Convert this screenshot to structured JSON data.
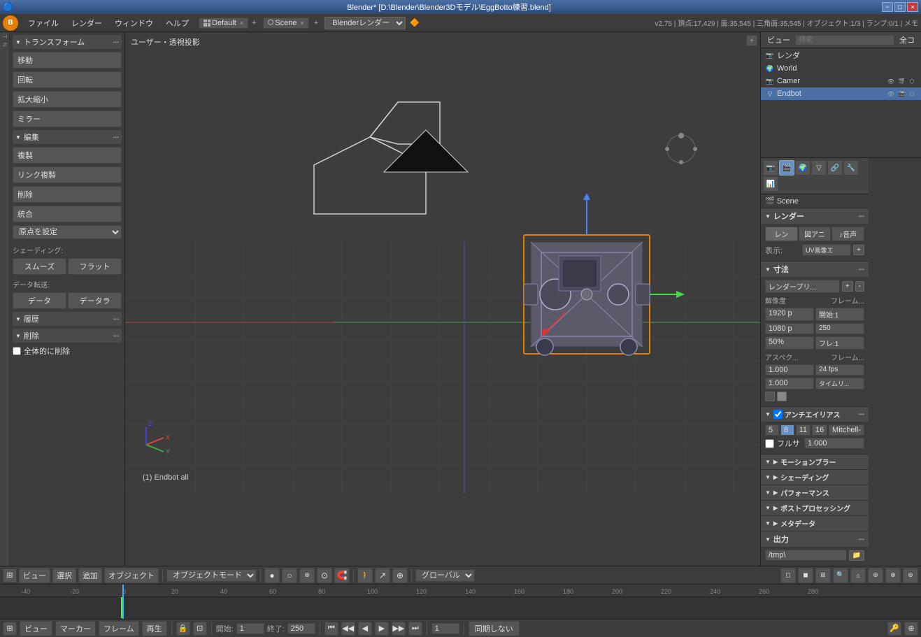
{
  "titlebar": {
    "title": "Blender*  [D:\\Blender\\Blender3Dモデル\\EggBotto練習.blend]",
    "controls": [
      "−",
      "□",
      "×"
    ]
  },
  "menubar": {
    "logo": "B",
    "items": [
      "ファイル",
      "レンダー",
      "ウィンドウ",
      "ヘルプ"
    ],
    "workspace": "Default",
    "scene": "Scene",
    "renderer": "Blenderレンダー",
    "stats": "v2.75 | 頂点:17,429 | 面:35,545 | 三角面:35,545 | オブジェクト:1/3 | ランプ:0/1 | メモ"
  },
  "left_panel": {
    "sections": {
      "transform": {
        "label": "トランスフォーム",
        "buttons": [
          "移動",
          "回転",
          "拡大縮小",
          "ミラー"
        ]
      },
      "edit": {
        "label": "編集",
        "buttons": [
          "複製",
          "リンク複製",
          "削除"
        ],
        "merge_btn": "統合",
        "origin_label": "原点を設定",
        "shading_label": "シェーディング:",
        "shading_btns": [
          "スムーズ",
          "フラット"
        ],
        "transfer_label": "データ転送:",
        "transfer_btns": [
          "データ",
          "データラ"
        ]
      },
      "history": {
        "label": "履歴"
      },
      "delete": {
        "label": "削除",
        "all_delete": "全体的に削除"
      }
    }
  },
  "viewport": {
    "label": "ユーザー・透視投影",
    "status": "(1) Endbot all"
  },
  "outliner": {
    "tabs": [
      "ビュー",
      "検索",
      "全コ"
    ],
    "items": [
      {
        "name": "レンダ",
        "icon": "📷",
        "indent": 0
      },
      {
        "name": "World",
        "icon": "🌍",
        "indent": 0
      },
      {
        "name": "Camer",
        "icon": "📷",
        "indent": 0,
        "visible": true
      },
      {
        "name": "Endbot",
        "icon": "▽",
        "indent": 0,
        "visible": true
      }
    ]
  },
  "properties": {
    "scene_name": "Scene",
    "sections": {
      "render": {
        "label": "レンダー",
        "tabs": [
          "レン",
          "図アニ",
          "♪音声"
        ],
        "display_label": "表示:",
        "display_value": "UV画像エ",
        "resolution": {
          "label": "解像度",
          "frame_label": "フレーム...",
          "width": "1920 p",
          "height": "1080 p",
          "start": "開始:1",
          "end": "250",
          "percent": "50%",
          "frame_current": "フレ:1"
        },
        "aspect": {
          "label": "アスペク...",
          "frame_label": "フレーム...",
          "x": "1.000",
          "fps": "24 fps",
          "y": "1.000",
          "time_remap": "タイムリ..."
        }
      },
      "dimensions": {
        "label": "寸法",
        "render_preset": "レンダープリ...",
        "add_btn": "+",
        "remove_btn": "-"
      },
      "anti_aliasing": {
        "label": "アンチエイリアス",
        "enabled": true,
        "values": [
          "5",
          "8",
          "11",
          "16"
        ],
        "active_value": "8",
        "filter": "Mitchell-",
        "full_sample": "フルサ",
        "full_value": "1.000"
      },
      "motion_blur": {
        "label": "モーションブラー"
      },
      "shading": {
        "label": "シェーディング"
      },
      "performance": {
        "label": "パフォーマンス"
      },
      "post_processing": {
        "label": "ポストプロセッシング"
      },
      "metadata": {
        "label": "メタデータ"
      },
      "output": {
        "label": "出力",
        "path": "/tmp\\"
      }
    }
  },
  "timeline": {
    "marks": [
      "-40",
      "-20",
      "0",
      "20",
      "40",
      "60",
      "80",
      "100",
      "120",
      "140",
      "160",
      "180",
      "200",
      "220",
      "240",
      "260",
      "280"
    ],
    "current_frame": "0"
  },
  "bottom_controls": {
    "view_btn": "ビュー",
    "marker_btn": "マーカー",
    "frame_btn": "フレーム",
    "play_btn": "再生",
    "start_label": "開始:",
    "start_val": "1",
    "end_label": "終了:",
    "end_val": "250",
    "current_frame": "1",
    "sync_btn": "同期しない"
  },
  "viewport_toolbar": {
    "view": "ビュー",
    "select": "選択",
    "add": "追加",
    "object": "オブジェクト",
    "mode": "オブジェクトモード",
    "viewport_shade": "●",
    "global": "グローバル"
  }
}
